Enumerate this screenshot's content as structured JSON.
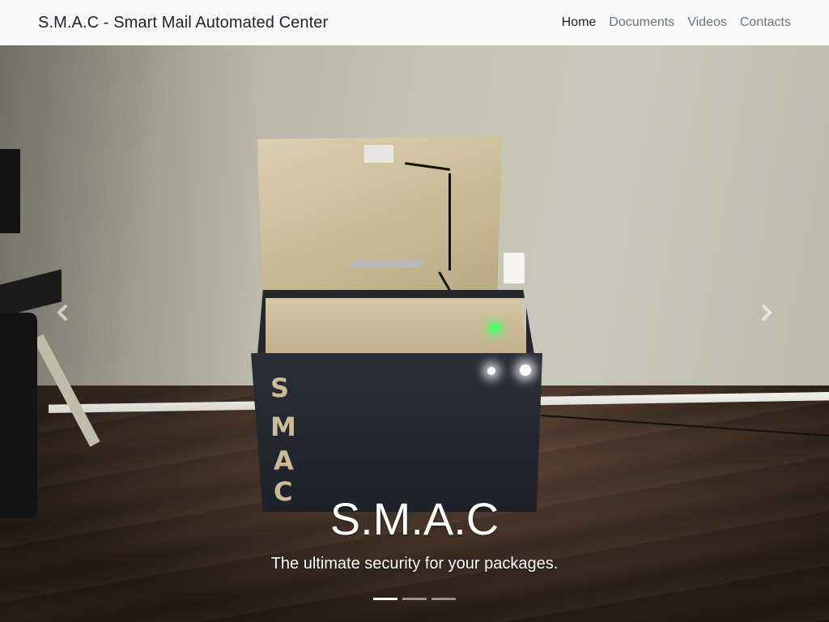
{
  "navbar": {
    "brand": "S.M.A.C - Smart Mail Automated Center",
    "links": [
      {
        "label": "Home",
        "active": true
      },
      {
        "label": "Documents",
        "active": false
      },
      {
        "label": "Videos",
        "active": false
      },
      {
        "label": "Contacts",
        "active": false
      }
    ]
  },
  "carousel": {
    "slide": {
      "box_letters": [
        "S",
        "M",
        "A",
        "C"
      ],
      "caption_title": "S.M.A.C",
      "caption_text": "The ultimate security for your packages."
    },
    "prev_icon": "chevron-left-icon",
    "next_icon": "chevron-right-icon",
    "indicators_count": 3,
    "active_index": 0
  },
  "colors": {
    "navbar_bg": "#f8f9fa",
    "link_active": "#212529",
    "link_muted": "#6c757d"
  }
}
